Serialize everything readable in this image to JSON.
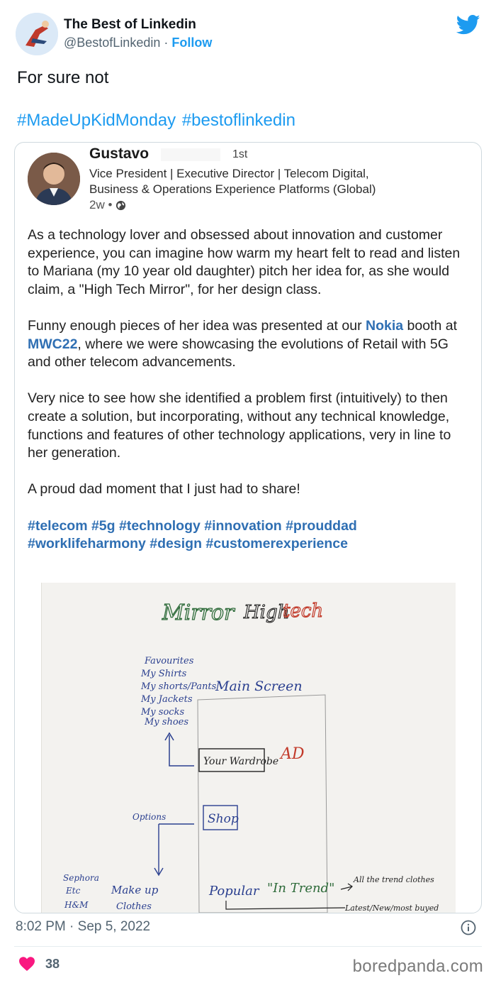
{
  "tweet": {
    "author_name": "The Best of Linkedin",
    "author_handle": "@BestofLinkedin",
    "separator": "·",
    "follow_label": "Follow",
    "text": "For sure not",
    "hashtags": [
      "#MadeUpKidMonday",
      "#bestoflinkedin"
    ],
    "timestamp": "8:02 PM · Sep 5, 2022",
    "like_count": "38"
  },
  "linkedin_post": {
    "author_name": "Gustavo",
    "connection_degree": "1st",
    "headline_line1": "Vice President | Executive Director | Telecom Digital,",
    "headline_line2": "Business & Operations Experience Platforms (Global)",
    "age": "2w •",
    "para1": "As a technology lover and obsessed about innovation and customer experience, you can imagine how warm my heart felt to read and listen to Mariana (my 10 year old daughter) pitch her idea for, as she would claim, a \"High Tech Mirror\", for her design class.",
    "para2_a": "Funny enough pieces of her idea was presented at our ",
    "para2_link1": "Nokia",
    "para2_b": " booth at ",
    "para2_link2": "MWC22",
    "para2_c": ", where we were showcasing the evolutions of Retail with 5G and other telecom advancements.",
    "para3": "Very nice to see how she identified a problem first (intuitively) to then create a solution, but incorporating, without any technical knowledge, functions and features of other technology applications, very in line to her generation.",
    "para4": "A proud dad moment that I just had to share!",
    "tags_line1": "#telecom #5g #technology #innovation #prouddad",
    "tags_line2": "#worklifeharmony #design #customerexperience"
  },
  "sketch": {
    "title_word1": "Mirror",
    "title_word2": "High",
    "title_word3": "tech",
    "list": [
      "Favourites",
      "My Shirts",
      "My shorts/Pants",
      "My Jackets",
      "My socks",
      "My shoes"
    ],
    "main_screen": "Main Screen",
    "your_wardrobe": "Your Wardrobe",
    "ad": "AD",
    "options": "Options",
    "shop": "Shop",
    "sephora": "Sephora",
    "etc": "Etc",
    "hm": "H&M",
    "make_up": "Make up",
    "clothes": "Clothes",
    "popular": "Popular",
    "in_trend": "\"In Trend\"",
    "all_trend": "All the trend clothes",
    "latest": "Latest/New/most buyed"
  },
  "watermark": "boredpanda.com",
  "colors": {
    "twitter_blue": "#1d9bf0",
    "linkedin_link": "#2f6fb3",
    "like_heart": "#f91880",
    "sketch_green": "#2e6b3a",
    "sketch_red": "#c23a2a",
    "sketch_blue": "#2a3f8f"
  },
  "icons": {
    "brand": "twitter-bird-icon",
    "visibility": "globe-icon",
    "info": "info-icon",
    "like": "heart-icon"
  }
}
